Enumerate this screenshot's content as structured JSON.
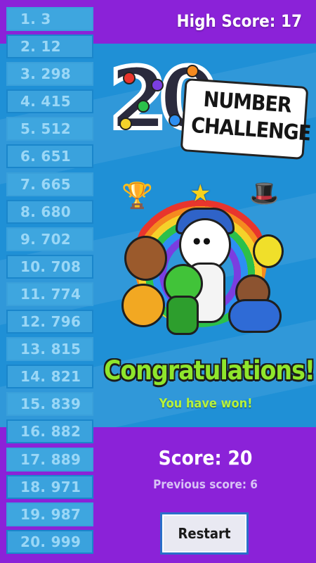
{
  "header": {
    "high_score_label": "High Score: 17"
  },
  "list": [
    {
      "label": "1. 3"
    },
    {
      "label": "2. 12"
    },
    {
      "label": "3. 298"
    },
    {
      "label": "4. 415"
    },
    {
      "label": "5. 512"
    },
    {
      "label": "6. 651"
    },
    {
      "label": "7. 665"
    },
    {
      "label": "8. 680"
    },
    {
      "label": "9. 702"
    },
    {
      "label": "10. 708"
    },
    {
      "label": "11. 774"
    },
    {
      "label": "12. 796"
    },
    {
      "label": "13. 815"
    },
    {
      "label": "14. 821"
    },
    {
      "label": "15. 839"
    },
    {
      "label": "16. 882"
    },
    {
      "label": "17. 889"
    },
    {
      "label": "18. 971"
    },
    {
      "label": "19. 987"
    },
    {
      "label": "20. 999"
    }
  ],
  "logo": {
    "number": "20",
    "line1": "NUMBER",
    "line2": "CHALLENGE"
  },
  "result": {
    "title": "Congratulations!",
    "subtitle": "You have won!",
    "score": "Score: 20",
    "previous_score": "Previous score: 6"
  },
  "actions": {
    "restart_label": "Restart"
  },
  "colors": {
    "background_purple": "#8b22d8",
    "band_blue": "#1f90d6",
    "list_item": "#3ea6df",
    "congrats_green": "#8fe62c"
  }
}
